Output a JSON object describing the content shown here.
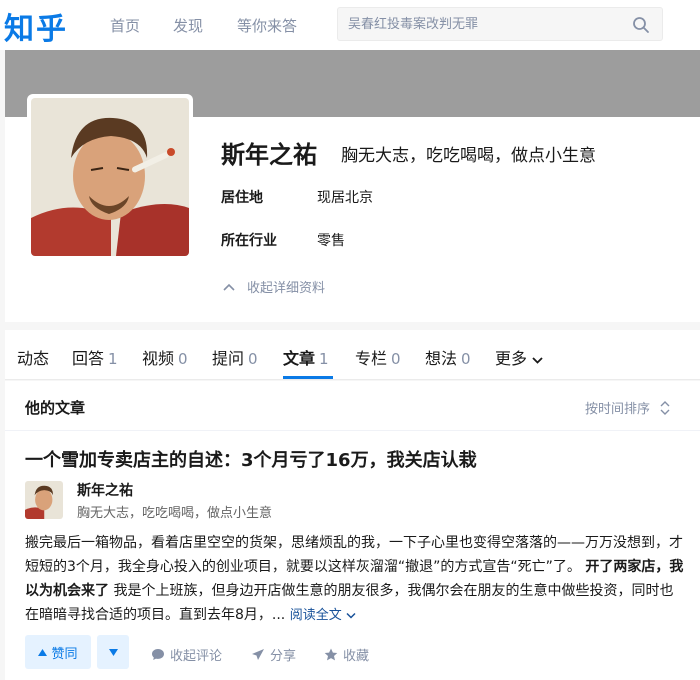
{
  "topbar": {
    "logo": "知乎",
    "nav": [
      "首页",
      "发现",
      "等你来答"
    ],
    "search_placeholder": "吴春红投毒案改判无罪"
  },
  "profile": {
    "name": "斯年之祐",
    "headline": "胸无大志，吃吃喝喝，做点小生意",
    "info": [
      {
        "label": "居住地",
        "value": "现居北京"
      },
      {
        "label": "所在行业",
        "value": "零售"
      }
    ],
    "collapse_label": "收起详细资料"
  },
  "tabs": [
    {
      "label": "动态",
      "count": ""
    },
    {
      "label": "回答",
      "count": "1"
    },
    {
      "label": "视频",
      "count": "0"
    },
    {
      "label": "提问",
      "count": "0"
    },
    {
      "label": "文章",
      "count": "1"
    },
    {
      "label": "专栏",
      "count": "0"
    },
    {
      "label": "想法",
      "count": "0"
    },
    {
      "label": "更多",
      "count": ""
    }
  ],
  "articles": {
    "heading": "他的文章",
    "sort_label": "按时间排序",
    "item": {
      "title": "一个雪加专卖店主的自述：3个月亏了16万，我关店认栽",
      "author_name": "斯年之祐",
      "author_bio": "胸无大志，吃吃喝喝，做点小生意",
      "excerpt_part1": "搬完最后一箱物品，看着店里空空的货架，思绪烦乱的我，一下子心里也变得空落落的——万万没想到，才短短的3个月，我全身心投入的创业项目，就要以这样灰溜溜“撤退”的方式宣告“死亡”了。",
      "excerpt_bold": "开了两家店，我以为机会来了",
      "excerpt_part2": "我是个上班族，但身边开店做生意的朋友很多，我偶尔会在朋友的生意中做些投资，同时也在暗暗寻找合适的项目。直到去年8月，...",
      "read_more": "阅读全文",
      "vote_up": "赞同",
      "comment": "收起评论",
      "share": "分享",
      "favorite": "收藏"
    }
  },
  "colors": {
    "accent": "#0a7ae6",
    "muted": "#8590a6",
    "cover": "#9d9d9d"
  }
}
